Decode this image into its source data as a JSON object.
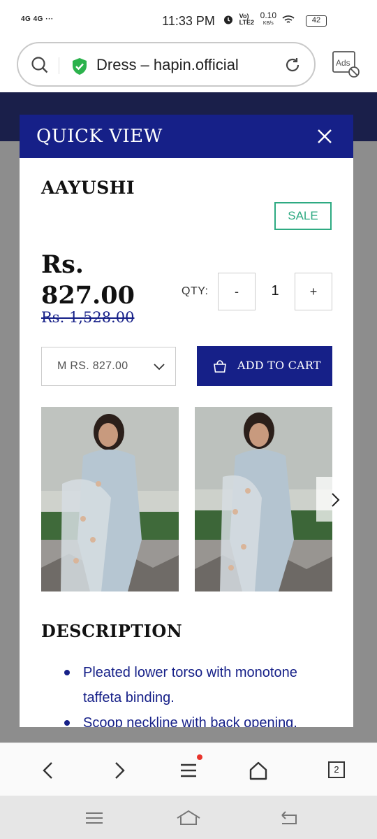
{
  "status_bar": {
    "signal": "4G 4G ···",
    "time": "11:33 PM",
    "network": "Vo) LTE2",
    "speed": "0.10",
    "speed_unit": "KB/s",
    "battery": "42"
  },
  "browser": {
    "url_text": "Dress – hapin.official",
    "ads_label": "Ads",
    "tabs_count": "2"
  },
  "quick_view": {
    "title": "QUICK VIEW",
    "product_name": "AAYUSHI",
    "sale_badge": "SALE",
    "price": "Rs. 827.00",
    "compare_price": "Rs. 1,528.00",
    "qty_label": "QTY:",
    "qty_minus": "-",
    "qty_value": "1",
    "qty_plus": "+",
    "variant_selected": "M RS. 827.00",
    "add_to_cart": "ADD TO CART",
    "description_title": "DESCRIPTION",
    "description_items": [
      "Pleated lower torso with monotone taffeta binding.",
      "Scoop neckline with back opening."
    ]
  },
  "colors": {
    "accent": "#162088",
    "sale": "#2eaa82"
  },
  "icons": {
    "search": "search-icon",
    "shield": "shield-check-icon",
    "reload": "reload-icon",
    "close": "close-icon",
    "chevron": "chevron-down-icon",
    "bag": "shopping-bag-icon",
    "next": "chevron-right-icon"
  }
}
